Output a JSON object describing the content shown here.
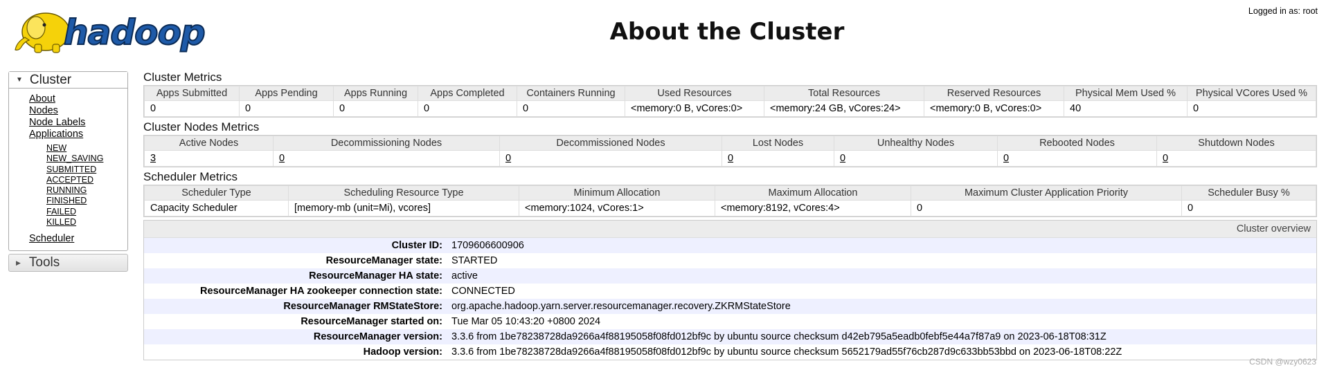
{
  "header": {
    "logo_text": "hadoop",
    "title": "About the Cluster",
    "logged_in": "Logged in as: root"
  },
  "sidebar": {
    "cluster_heading": "Cluster",
    "links": [
      "About",
      "Nodes",
      "Node Labels",
      "Applications"
    ],
    "app_states": [
      "NEW",
      "NEW_SAVING",
      "SUBMITTED",
      "ACCEPTED",
      "RUNNING",
      "FINISHED",
      "FAILED",
      "KILLED"
    ],
    "scheduler": "Scheduler",
    "tools_heading": "Tools"
  },
  "cluster_metrics": {
    "title": "Cluster Metrics",
    "headers": [
      "Apps Submitted",
      "Apps Pending",
      "Apps Running",
      "Apps Completed",
      "Containers Running",
      "Used Resources",
      "Total Resources",
      "Reserved Resources",
      "Physical Mem Used %",
      "Physical VCores Used %"
    ],
    "values": [
      "0",
      "0",
      "0",
      "0",
      "0",
      "<memory:0 B, vCores:0>",
      "<memory:24 GB, vCores:24>",
      "<memory:0 B, vCores:0>",
      "40",
      "0"
    ]
  },
  "node_metrics": {
    "title": "Cluster Nodes Metrics",
    "headers": [
      "Active Nodes",
      "Decommissioning Nodes",
      "Decommissioned Nodes",
      "Lost Nodes",
      "Unhealthy Nodes",
      "Rebooted Nodes",
      "Shutdown Nodes"
    ],
    "values": [
      "3",
      "0",
      "0",
      "0",
      "0",
      "0",
      "0"
    ]
  },
  "scheduler_metrics": {
    "title": "Scheduler Metrics",
    "headers": [
      "Scheduler Type",
      "Scheduling Resource Type",
      "Minimum Allocation",
      "Maximum Allocation",
      "Maximum Cluster Application Priority",
      "Scheduler Busy %"
    ],
    "values": [
      "Capacity Scheduler",
      "[memory-mb (unit=Mi), vcores]",
      "<memory:1024, vCores:1>",
      "<memory:8192, vCores:4>",
      "0",
      "0"
    ]
  },
  "overview": {
    "heading": "Cluster overview",
    "rows": [
      {
        "label": "Cluster ID:",
        "value": "1709606600906"
      },
      {
        "label": "ResourceManager state:",
        "value": "STARTED"
      },
      {
        "label": "ResourceManager HA state:",
        "value": "active"
      },
      {
        "label": "ResourceManager HA zookeeper connection state:",
        "value": "CONNECTED"
      },
      {
        "label": "ResourceManager RMStateStore:",
        "value": "org.apache.hadoop.yarn.server.resourcemanager.recovery.ZKRMStateStore"
      },
      {
        "label": "ResourceManager started on:",
        "value": "Tue Mar 05 10:43:20 +0800 2024"
      },
      {
        "label": "ResourceManager version:",
        "value": "3.3.6 from 1be78238728da9266a4f88195058f08fd012bf9c by ubuntu source checksum d42eb795a5eadb0febf5e44a7f87a9 on 2023-06-18T08:31Z"
      },
      {
        "label": "Hadoop version:",
        "value": "3.3.6 from 1be78238728da9266a4f88195058f08fd012bf9c by ubuntu source checksum 5652179ad55f76cb287d9c633bb53bbd on 2023-06-18T08:22Z"
      }
    ]
  },
  "watermark": "CSDN @wzy0623",
  "colors": {
    "logo_yellow": "#f5d20a",
    "logo_blue": "#1e5aa8",
    "row_alt": "#eef0ff",
    "header_bg": "#ececec"
  }
}
